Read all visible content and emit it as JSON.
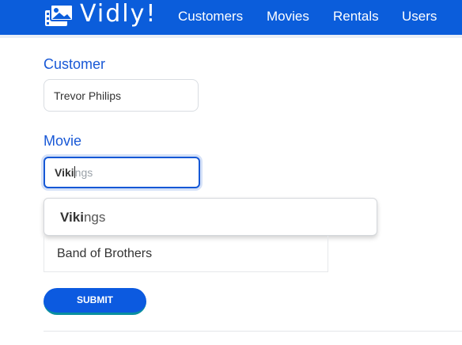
{
  "brand": {
    "name": "Vidly!",
    "icon": "film-icon"
  },
  "nav": {
    "items": [
      {
        "label": "Customers"
      },
      {
        "label": "Movies"
      },
      {
        "label": "Rentals"
      },
      {
        "label": "Users"
      }
    ]
  },
  "form": {
    "customer_label": "Customer",
    "customer_value": "Trevor Philips",
    "movie_label": "Movie",
    "movie_typed": "Viki",
    "movie_suggestion_rest": "ngs",
    "suggestions": [
      {
        "match": "Viki",
        "rest": "ngs"
      }
    ],
    "selected_movies": [
      {
        "title": "Band of Brothers"
      }
    ],
    "submit_label": "SUBMIT"
  },
  "colors": {
    "navbar": "#0b5ddb",
    "label": "#1858d6",
    "button": "#0c5ae0"
  }
}
